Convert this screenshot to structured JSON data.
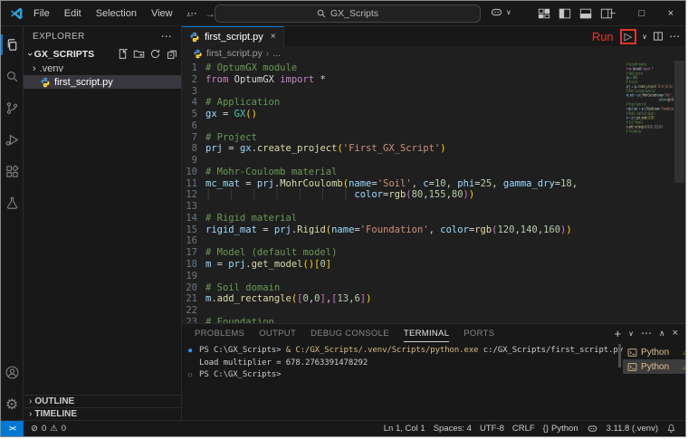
{
  "colors": {
    "accent": "#0078D4",
    "annotation_red": "#E0362C",
    "terminal_warning": "#CCA700",
    "selected_row": "#37373D"
  },
  "title_bar": {
    "menus": [
      {
        "label": "File"
      },
      {
        "label": "Edit"
      },
      {
        "label": "Selection"
      },
      {
        "label": "View"
      },
      {
        "label": "⋯"
      }
    ],
    "search_value": "GX_Scripts",
    "window_controls": {
      "minimize": "−",
      "maximize": "□",
      "close": "×"
    }
  },
  "activity_bar": {
    "items": [
      "explorer",
      "search",
      "source-control",
      "run-and-debug",
      "extensions",
      "testing"
    ],
    "active_item": "explorer",
    "bottom_items": [
      "accounts",
      "settings"
    ]
  },
  "explorer": {
    "title": "EXPLORER",
    "more_label": "⋯",
    "section": "GX_SCRIPTS",
    "items": [
      {
        "label": ".venv",
        "type": "folder"
      },
      {
        "label": "first_script.py",
        "type": "python-file",
        "selected": true
      }
    ],
    "bottom_panels": [
      {
        "label": "OUTLINE"
      },
      {
        "label": "TIMELINE"
      }
    ]
  },
  "editor": {
    "tab_label": "first_script.py",
    "breadcrumb": [
      "first_script.py",
      "..."
    ],
    "run_annotation": "Run",
    "run_play_glyph": "▷",
    "code_lines": [
      [
        {
          "c": "cm",
          "t": "# OptumGX module"
        }
      ],
      [
        {
          "c": "kw",
          "t": "from"
        },
        {
          "c": "pl",
          "t": " OptumGX "
        },
        {
          "c": "kw",
          "t": "import"
        },
        {
          "c": "pl",
          "t": " *"
        }
      ],
      [],
      [
        {
          "c": "cm",
          "t": "# Application"
        }
      ],
      [
        {
          "c": "v",
          "t": "gx"
        },
        {
          "c": "pl",
          "t": " = "
        },
        {
          "c": "ty",
          "t": "GX"
        },
        {
          "c": "b1",
          "t": "()"
        }
      ],
      [],
      [
        {
          "c": "cm",
          "t": "# Project"
        }
      ],
      [
        {
          "c": "v",
          "t": "prj"
        },
        {
          "c": "pl",
          "t": " = "
        },
        {
          "c": "v",
          "t": "gx"
        },
        {
          "c": "pl",
          "t": "."
        },
        {
          "c": "fn",
          "t": "create_project"
        },
        {
          "c": "b1",
          "t": "("
        },
        {
          "c": "st",
          "t": "'First_GX_Script'"
        },
        {
          "c": "b1",
          "t": ")"
        }
      ],
      [],
      [
        {
          "c": "cm",
          "t": "# Mohr-Coulomb material"
        }
      ],
      [
        {
          "c": "v",
          "t": "mc_mat"
        },
        {
          "c": "pl",
          "t": " = "
        },
        {
          "c": "v",
          "t": "prj"
        },
        {
          "c": "pl",
          "t": "."
        },
        {
          "c": "fn",
          "t": "MohrCoulomb"
        },
        {
          "c": "b1",
          "t": "("
        },
        {
          "c": "v",
          "t": "name"
        },
        {
          "c": "pl",
          "t": "="
        },
        {
          "c": "st",
          "t": "'Soil'"
        },
        {
          "c": "pl",
          "t": ", "
        },
        {
          "c": "v",
          "t": "c"
        },
        {
          "c": "pl",
          "t": "="
        },
        {
          "c": "nu",
          "t": "10"
        },
        {
          "c": "pl",
          "t": ", "
        },
        {
          "c": "v",
          "t": "phi"
        },
        {
          "c": "pl",
          "t": "="
        },
        {
          "c": "nu",
          "t": "25"
        },
        {
          "c": "pl",
          "t": ", "
        },
        {
          "c": "v",
          "t": "gamma_dry"
        },
        {
          "c": "pl",
          "t": "="
        },
        {
          "c": "nu",
          "t": "18"
        },
        {
          "c": "pl",
          "t": ","
        }
      ],
      [
        {
          "c": "ig",
          "t": "│   │   │   │   │   │   │ "
        },
        {
          "c": "v",
          "t": "color"
        },
        {
          "c": "pl",
          "t": "="
        },
        {
          "c": "fn",
          "t": "rgb"
        },
        {
          "c": "b2",
          "t": "("
        },
        {
          "c": "nu",
          "t": "80"
        },
        {
          "c": "pl",
          "t": ","
        },
        {
          "c": "nu",
          "t": "155"
        },
        {
          "c": "pl",
          "t": ","
        },
        {
          "c": "nu",
          "t": "80"
        },
        {
          "c": "b2",
          "t": ")"
        },
        {
          "c": "b1",
          "t": ")"
        }
      ],
      [],
      [
        {
          "c": "cm",
          "t": "# Rigid material"
        }
      ],
      [
        {
          "c": "v",
          "t": "rigid_mat"
        },
        {
          "c": "pl",
          "t": " = "
        },
        {
          "c": "v",
          "t": "prj"
        },
        {
          "c": "pl",
          "t": "."
        },
        {
          "c": "fn",
          "t": "Rigid"
        },
        {
          "c": "b1",
          "t": "("
        },
        {
          "c": "v",
          "t": "name"
        },
        {
          "c": "pl",
          "t": "="
        },
        {
          "c": "st",
          "t": "'Foundation'"
        },
        {
          "c": "pl",
          "t": ", "
        },
        {
          "c": "v",
          "t": "color"
        },
        {
          "c": "pl",
          "t": "="
        },
        {
          "c": "fn",
          "t": "rgb"
        },
        {
          "c": "b2",
          "t": "("
        },
        {
          "c": "nu",
          "t": "120"
        },
        {
          "c": "pl",
          "t": ","
        },
        {
          "c": "nu",
          "t": "140"
        },
        {
          "c": "pl",
          "t": ","
        },
        {
          "c": "nu",
          "t": "160"
        },
        {
          "c": "b2",
          "t": ")"
        },
        {
          "c": "b1",
          "t": ")"
        }
      ],
      [],
      [
        {
          "c": "cm",
          "t": "# Model (default model)"
        }
      ],
      [
        {
          "c": "v",
          "t": "m"
        },
        {
          "c": "pl",
          "t": " = "
        },
        {
          "c": "v",
          "t": "prj"
        },
        {
          "c": "pl",
          "t": "."
        },
        {
          "c": "fn",
          "t": "get_model"
        },
        {
          "c": "b1",
          "t": "()["
        },
        {
          "c": "nu",
          "t": "0"
        },
        {
          "c": "b1",
          "t": "]"
        }
      ],
      [],
      [
        {
          "c": "cm",
          "t": "# Soil domain"
        }
      ],
      [
        {
          "c": "v",
          "t": "m"
        },
        {
          "c": "pl",
          "t": "."
        },
        {
          "c": "fn",
          "t": "add_rectangle"
        },
        {
          "c": "b1",
          "t": "("
        },
        {
          "c": "b2",
          "t": "["
        },
        {
          "c": "nu",
          "t": "0"
        },
        {
          "c": "pl",
          "t": ","
        },
        {
          "c": "nu",
          "t": "0"
        },
        {
          "c": "b2",
          "t": "]"
        },
        {
          "c": "pl",
          "t": ","
        },
        {
          "c": "b2",
          "t": "["
        },
        {
          "c": "nu",
          "t": "13"
        },
        {
          "c": "pl",
          "t": ","
        },
        {
          "c": "nu",
          "t": "6"
        },
        {
          "c": "b2",
          "t": "]"
        },
        {
          "c": "b1",
          "t": ")"
        }
      ],
      [],
      [
        {
          "c": "cm",
          "t": "# Foundation"
        }
      ]
    ]
  },
  "panel": {
    "tabs": [
      {
        "label": "PROBLEMS"
      },
      {
        "label": "OUTPUT"
      },
      {
        "label": "DEBUG CONSOLE"
      },
      {
        "label": "TERMINAL",
        "active": true
      },
      {
        "label": "PORTS"
      }
    ],
    "actions": {
      "new_terminal": "+",
      "profile_dropdown": "∨",
      "more": "⋯",
      "maximize": "∧",
      "close": "×"
    },
    "terminal": {
      "lines": [
        {
          "deco": "run",
          "spans": [
            {
              "c": "tp",
              "t": "PS C:\\GX_Scripts> "
            },
            {
              "c": "tc",
              "t": "& C:/GX_Scripts/.venv/Scripts/python.exe"
            },
            {
              "c": "tp",
              "t": " c:/GX_Scripts/first_script.py"
            }
          ]
        },
        {
          "deco": null,
          "spans": [
            {
              "c": "tp",
              "t": "Load multiplier = 678.2763391478292"
            }
          ]
        },
        {
          "deco": "pending",
          "spans": [
            {
              "c": "tp",
              "t": "PS C:\\GX_Scripts>"
            }
          ]
        }
      ],
      "list": [
        {
          "label": "Python"
        },
        {
          "label": "Python",
          "selected": true
        }
      ]
    }
  },
  "status_bar": {
    "errors": "0",
    "warnings": "0",
    "cursor_position": "Ln 1, Col 1",
    "indentation": "Spaces: 4",
    "encoding": "UTF-8",
    "eol": "CRLF",
    "language_glyph": "{}",
    "language": "Python",
    "interpreter": "3.11.8 (.venv)"
  }
}
